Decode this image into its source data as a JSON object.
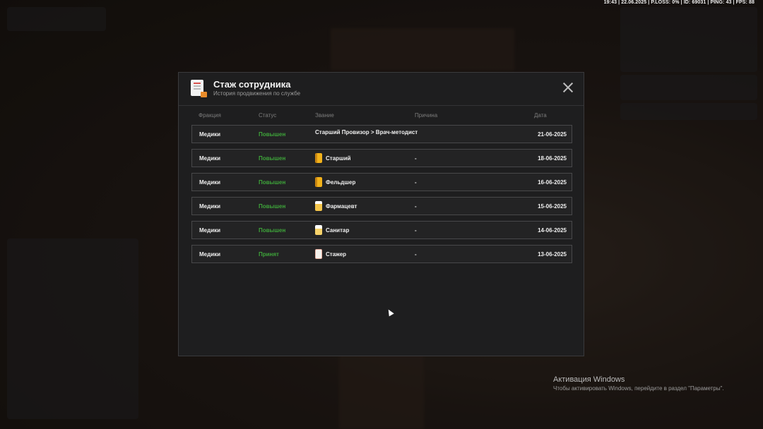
{
  "hud": {
    "status_line": "19:43 | 22.06.2025 | P.LOSS: 0% | ID: 69031 | PING: 43 | FPS: 88"
  },
  "modal": {
    "title": "Стаж сотрудника",
    "subtitle": "История продвижения по службе",
    "icon": "document-badge-icon",
    "close_icon": "close-icon",
    "columns": [
      "Фракция",
      "Статус",
      "Звание",
      "Причина",
      "Дата"
    ],
    "rows": [
      {
        "faction": "Медики",
        "status": "Повышен",
        "rank": "Старший Провизор > Врач-методист",
        "rank_icon": "",
        "reason": "",
        "date": "21-06-2025"
      },
      {
        "faction": "Медики",
        "status": "Повышен",
        "rank": "Старший",
        "rank_icon": "gold-rank-icon",
        "reason": "-",
        "date": "18-06-2025"
      },
      {
        "faction": "Медики",
        "status": "Повышен",
        "rank": "Фельдшер",
        "rank_icon": "gold-rank-icon",
        "reason": "-",
        "date": "16-06-2025"
      },
      {
        "faction": "Медики",
        "status": "Повышен",
        "rank": "Фармацевт",
        "rank_icon": "pharm-rank-icon",
        "reason": "-",
        "date": "15-06-2025"
      },
      {
        "faction": "Медики",
        "status": "Повышен",
        "rank": "Санитар",
        "rank_icon": "sanitar-rank-icon",
        "reason": "-",
        "date": "14-06-2025"
      },
      {
        "faction": "Медики",
        "status": "Принят",
        "rank": "Стажер",
        "rank_icon": "trainee-rank-icon",
        "reason": "-",
        "date": "13-06-2025"
      }
    ],
    "status_color": "#3ea43a"
  },
  "windows_activation": {
    "title": "Активация Windows",
    "text": "Чтобы активировать Windows, перейдите в раздел \"Параметры\"."
  }
}
